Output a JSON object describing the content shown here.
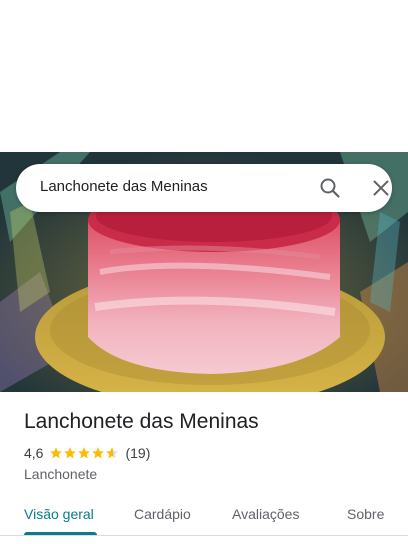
{
  "search": {
    "query": "Lanchonete das Meninas",
    "search_icon": "search-icon",
    "close_icon": "close-icon"
  },
  "hero": {
    "image_subject": "photo"
  },
  "place": {
    "name": "Lanchonete das Meninas",
    "rating": "4,6",
    "rating_value": 4.6,
    "reviews": "(19)",
    "category": "Lanchonete",
    "star_color": "#fbbc04"
  },
  "tabs": [
    {
      "label": "Visão geral",
      "active": true
    },
    {
      "label": "Cardápio",
      "active": false
    },
    {
      "label": "Avaliações",
      "active": false
    },
    {
      "label": "Sobre",
      "active": false
    }
  ],
  "colors": {
    "accent": "#0b7a8a",
    "text_primary": "#202124",
    "text_secondary": "#5f6368"
  }
}
